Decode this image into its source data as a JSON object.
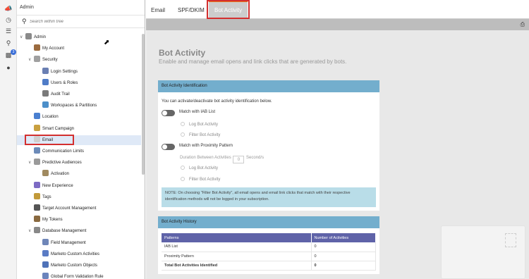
{
  "rail": {
    "icons": [
      "megaphone-icon",
      "history-icon",
      "list-icon",
      "search-icon",
      "chart-icon",
      "person-icon"
    ],
    "badge": "3"
  },
  "tree": {
    "header": "Admin",
    "search_placeholder": "Search within tree",
    "items": [
      {
        "label": "Admin",
        "level": 0,
        "expanded": true
      },
      {
        "label": "My Account",
        "level": 1
      },
      {
        "label": "Security",
        "level": 1,
        "expanded": true
      },
      {
        "label": "Login Settings",
        "level": 2
      },
      {
        "label": "Users & Roles",
        "level": 2
      },
      {
        "label": "Audit Trail",
        "level": 2
      },
      {
        "label": "Workspaces & Partitions",
        "level": 2
      },
      {
        "label": "Location",
        "level": 1
      },
      {
        "label": "Smart Campaign",
        "level": 1
      },
      {
        "label": "Email",
        "level": 1,
        "selected": true
      },
      {
        "label": "Communication Limits",
        "level": 1
      },
      {
        "label": "Predictive Audiences",
        "level": 1,
        "expanded": true
      },
      {
        "label": "Activation",
        "level": 2
      },
      {
        "label": "New Experience",
        "level": 1
      },
      {
        "label": "Tags",
        "level": 1
      },
      {
        "label": "Target Account Management",
        "level": 1
      },
      {
        "label": "My Tokens",
        "level": 1
      },
      {
        "label": "Database Management",
        "level": 1,
        "expanded": true
      },
      {
        "label": "Field Management",
        "level": 2
      },
      {
        "label": "Marketo Custom Activities",
        "level": 2
      },
      {
        "label": "Marketo Custom Objects",
        "level": 2
      },
      {
        "label": "Global Form Validation Rule",
        "level": 2
      }
    ]
  },
  "tabs": [
    {
      "label": "Email"
    },
    {
      "label": "SPF/DKIM"
    },
    {
      "label": "Bot Activity",
      "active": true
    }
  ],
  "page": {
    "title": "Bot Activity",
    "subtitle": "Enable and manage email opens and link clicks that are generated by bots."
  },
  "identification": {
    "header": "Bot Activity Identification",
    "intro": "You can activate/deactivate bot activity identification below.",
    "iab_label": "Match with IAB List",
    "iab_log": "Log Bot Activity",
    "iab_filter": "Filter Bot Activity",
    "proximity_label": "Match with Proximity Pattern",
    "duration_label": "Duration Between Activities",
    "duration_value": "0",
    "duration_unit": "Second/s",
    "prox_log": "Log Bot Activity",
    "prox_filter": "Filter Bot Activity",
    "note": "NOTE: On choosing \"Filter Bot Activity\", all email opens and email link clicks that match with their respective identification methods will not be logged in your subscription."
  },
  "history": {
    "header": "Bot Activity History",
    "columns": [
      "Patterns",
      "Number of Activities"
    ],
    "rows": [
      [
        "IAB List",
        "0"
      ],
      [
        "Proximity Pattern",
        "0"
      ]
    ],
    "total_label": "Total Bot Activities Identified",
    "total_value": "0"
  },
  "colors": {
    "panel_header": "#73aecd",
    "table_header": "#5f63a8",
    "note_bg": "#b9dde8",
    "highlight": "#d32f2f",
    "tab_accent": "#e87a20"
  }
}
